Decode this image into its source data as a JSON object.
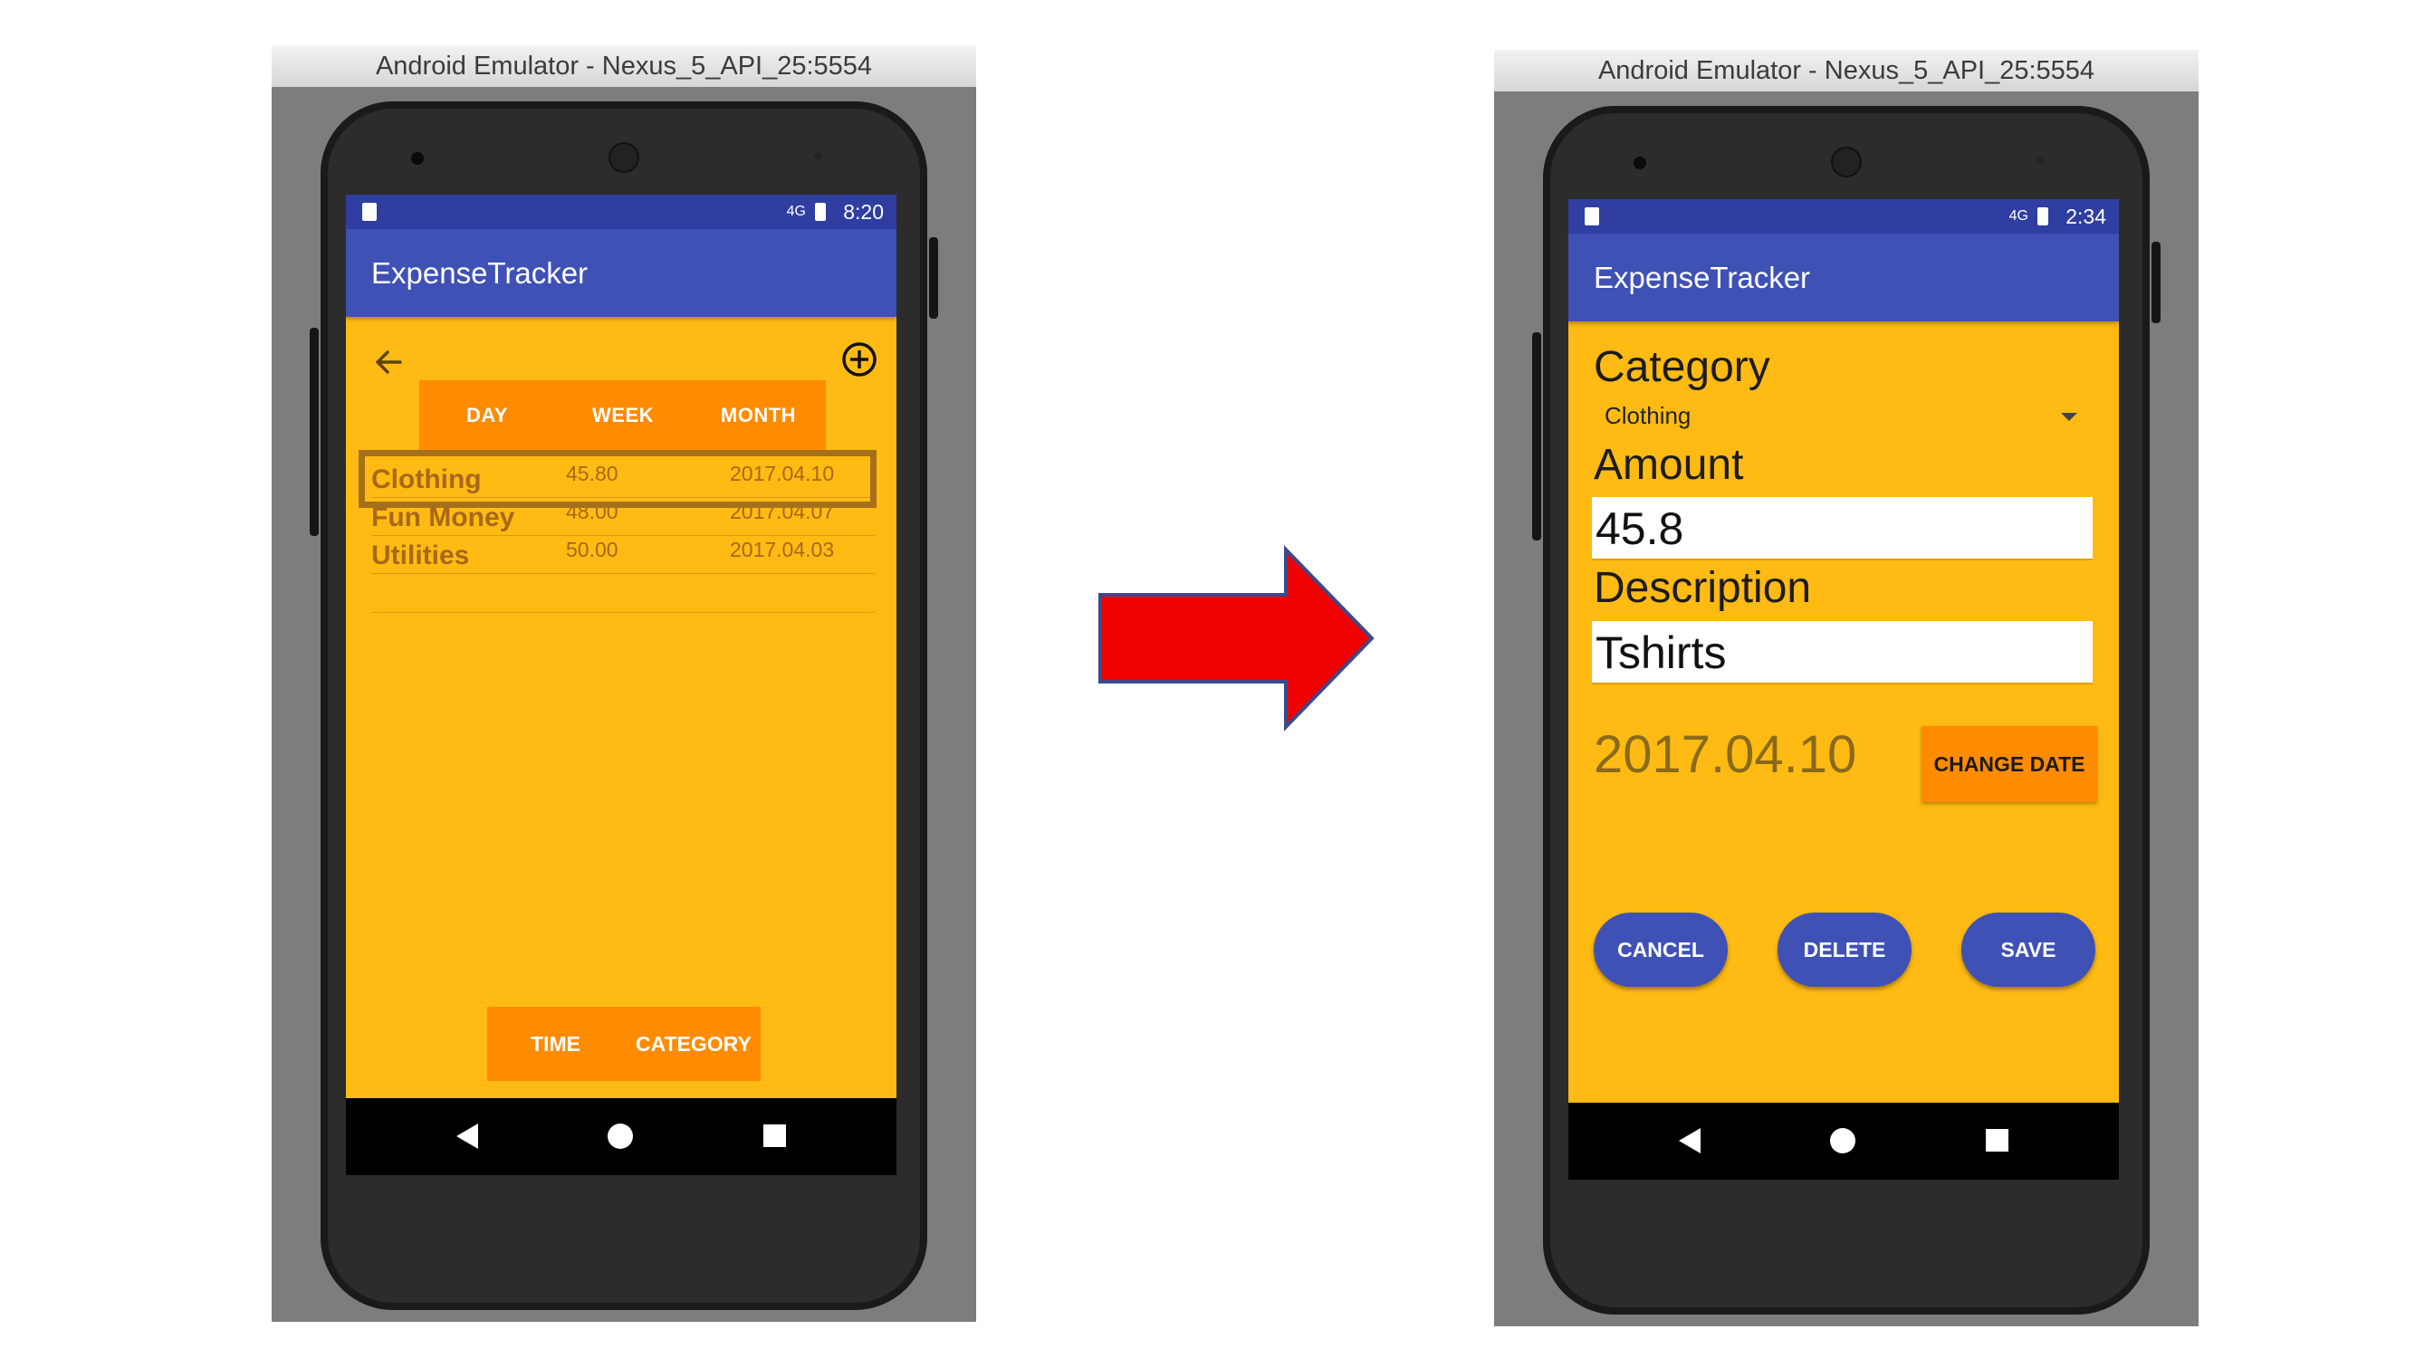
{
  "left_window": {
    "title": "Android Emulator - Nexus_5_API_25:5554",
    "status_time": "8:20",
    "signal": "4G",
    "app_title": "ExpenseTracker",
    "tabs": [
      "DAY",
      "WEEK",
      "MONTH"
    ],
    "expenses": [
      {
        "category": "Clothing",
        "amount": "45.80",
        "date": "2017.04.10"
      },
      {
        "category": "Fun Money",
        "amount": "48.00",
        "date": "2017.04.07"
      },
      {
        "category": "Utilities",
        "amount": "50.00",
        "date": "2017.04.03"
      }
    ],
    "bottom_tabs": [
      "TIME",
      "CATEGORY"
    ]
  },
  "right_window": {
    "title": "Android Emulator - Nexus_5_API_25:5554",
    "status_time": "2:34",
    "signal": "4G",
    "app_title": "ExpenseTracker",
    "category_label": "Category",
    "category_value": "Clothing",
    "amount_label": "Amount",
    "amount_value": "45.8",
    "description_label": "Description",
    "description_value": "Tshirts",
    "date_value": "2017.04.10",
    "change_date_label": "CHANGE DATE",
    "cancel_label": "CANCEL",
    "delete_label": "DELETE",
    "save_label": "SAVE"
  },
  "colors": {
    "screen_bg": "#FFBB13",
    "accent_orange": "#FF8B00",
    "app_bar": "#3F51B5",
    "status_bar": "#2F3EA0",
    "arrow": "#F00000",
    "highlight_border": "#A5701B"
  }
}
